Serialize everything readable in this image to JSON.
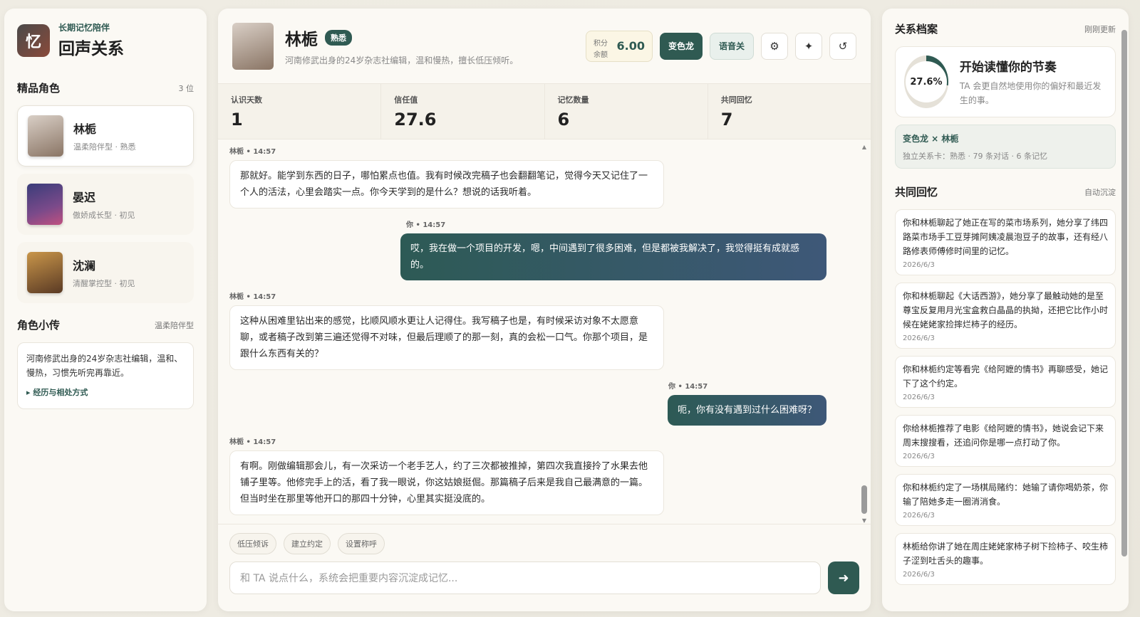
{
  "brand": {
    "logo_char": "忆",
    "subtitle": "长期记忆陪伴",
    "title": "回声关系"
  },
  "roles": {
    "title": "精品角色",
    "count": "3 位",
    "items": [
      {
        "name": "林栀",
        "desc": "温柔陪伴型 · 熟悉"
      },
      {
        "name": "晏迟",
        "desc": "傲娇成长型 · 初见"
      },
      {
        "name": "沈澜",
        "desc": "清醒掌控型 · 初见"
      }
    ]
  },
  "bio": {
    "title": "角色小传",
    "tag": "温柔陪伴型",
    "text": "河南修武出身的24岁杂志社编辑，温和、慢热，习惯先听完再靠近。",
    "link": "▸ 经历与相处方式"
  },
  "chat": {
    "name": "林栀",
    "badge": "熟悉",
    "subtitle": "河南修武出身的24岁杂志社编辑，温和慢热，擅长低压倾听。",
    "points_label1": "积分",
    "points_label2": "余额",
    "points_value": "6.00",
    "btn_user": "变色龙",
    "btn_voice": "语音关",
    "icon_settings": "⚙",
    "icon_star": "✦",
    "icon_refresh": "↺",
    "stats": [
      {
        "label": "认识天数",
        "value": "1"
      },
      {
        "label": "信任值",
        "value": "27.6"
      },
      {
        "label": "记忆数量",
        "value": "6"
      },
      {
        "label": "共同回忆",
        "value": "7"
      }
    ],
    "messages": [
      {
        "meta": "林栀 • 14:57",
        "text": "那就好。能学到东西的日子，哪怕累点也值。我有时候改完稿子也会翻翻笔记，觉得今天又记住了一个人的活法，心里会踏实一点。你今天学到的是什么？想说的话我听着。"
      },
      {
        "meta": "你 • 14:57",
        "text": "哎，我在做一个项目的开发，嗯，中间遇到了很多困难，但是都被我解决了，我觉得挺有成就感的。"
      },
      {
        "meta": "林栀 • 14:57",
        "text": "这种从困难里钻出来的感觉，比顺风顺水更让人记得住。我写稿子也是，有时候采访对象不太愿意聊，或者稿子改到第三遍还觉得不对味，但最后理顺了的那一刻，真的会松一口气。你那个项目，是跟什么东西有关的？"
      },
      {
        "meta": "你 • 14:57",
        "text": "呃，你有没有遇到过什么困难呀？"
      },
      {
        "meta": "林栀 • 14:57",
        "text": "有啊。刚做编辑那会儿，有一次采访一个老手艺人，约了三次都被推掉，第四次我直接拎了水果去他铺子里等。他修完手上的活，看了我一眼说，你这姑娘挺倔。那篇稿子后来是我自己最满意的一篇。但当时坐在那里等他开口的那四十分钟，心里其实挺没底的。"
      }
    ],
    "chips": [
      "低压倾诉",
      "建立约定",
      "设置称呼"
    ],
    "input_placeholder": "和 TA 说点什么，系统会把重要内容沉淀成记忆...",
    "send_icon": "➜"
  },
  "profile": {
    "title": "关系档案",
    "meta": "刚刚更新",
    "progress_value": 27.6,
    "progress_text": "27.6%",
    "progress_title": "开始读懂你的节奏",
    "progress_desc": "TA 会更自然地使用你的偏好和最近发生的事。",
    "rel_title": "变色龙 × 林栀",
    "rel_desc": "独立关系卡：熟悉 · 79 条对话 · 6 条记忆"
  },
  "memories": {
    "title": "共同回忆",
    "meta": "自动沉淀",
    "items": [
      {
        "text": "你和林栀聊起了她正在写的菜市场系列，她分享了纬四路菜市场手工豆芽摊阿姨凌晨泡豆子的故事，还有经八路修表师傅修时间里的记忆。",
        "date": "2026/6/3"
      },
      {
        "text": "你和林栀聊起《大话西游》，她分享了最触动她的是至尊宝反复用月光宝盒救白晶晶的执拗，还把它比作小时候在姥姥家捡摔烂柿子的经历。",
        "date": "2026/6/3"
      },
      {
        "text": "你和林栀约定等看完《给阿嬷的情书》再聊感受，她记下了这个约定。",
        "date": "2026/6/3"
      },
      {
        "text": "你给林栀推荐了电影《给阿嬷的情书》，她说会记下来周末搜搜看，还追问你是哪一点打动了你。",
        "date": "2026/6/3"
      },
      {
        "text": "你和林栀约定了一场棋局赌约：她输了请你喝奶茶，你输了陪她多走一圈消消食。",
        "date": "2026/6/3"
      },
      {
        "text": "林栀给你讲了她在周庄姥姥家柿子树下捡柿子、咬生柿子涩到吐舌头的趣事。",
        "date": "2026/6/3"
      }
    ]
  },
  "colors": {
    "accent": "#2f5a52",
    "bubble_user_start": "#2d5a55",
    "bubble_user_end": "#3e5878",
    "ring_track": "#e5e1d8"
  }
}
